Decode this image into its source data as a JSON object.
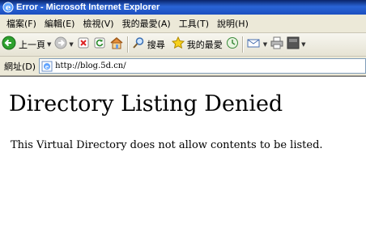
{
  "window": {
    "title": "Error - Microsoft Internet Explorer"
  },
  "menubar": {
    "items": [
      "檔案(F)",
      "編輯(E)",
      "檢視(V)",
      "我的最愛(A)",
      "工具(T)",
      "說明(H)"
    ]
  },
  "toolbar": {
    "back_label": "上一頁",
    "search_label": "搜尋",
    "favorites_label": "我的最愛"
  },
  "addressbar": {
    "label": "網址(D)",
    "url": "http://blog.5d.cn/"
  },
  "page": {
    "heading": "Directory Listing Denied",
    "message": "This Virtual Directory does not allow contents to be listed."
  },
  "colors": {
    "title_bar": "#0a246a",
    "chrome": "#ece9d8",
    "content_bg": "#ffffff"
  },
  "icons": [
    "ie-logo-icon",
    "back-arrow-icon",
    "forward-arrow-icon",
    "stop-icon",
    "refresh-icon",
    "home-icon",
    "search-icon",
    "favorites-star-icon",
    "history-icon",
    "mail-icon",
    "print-icon",
    "edit-icon"
  ]
}
